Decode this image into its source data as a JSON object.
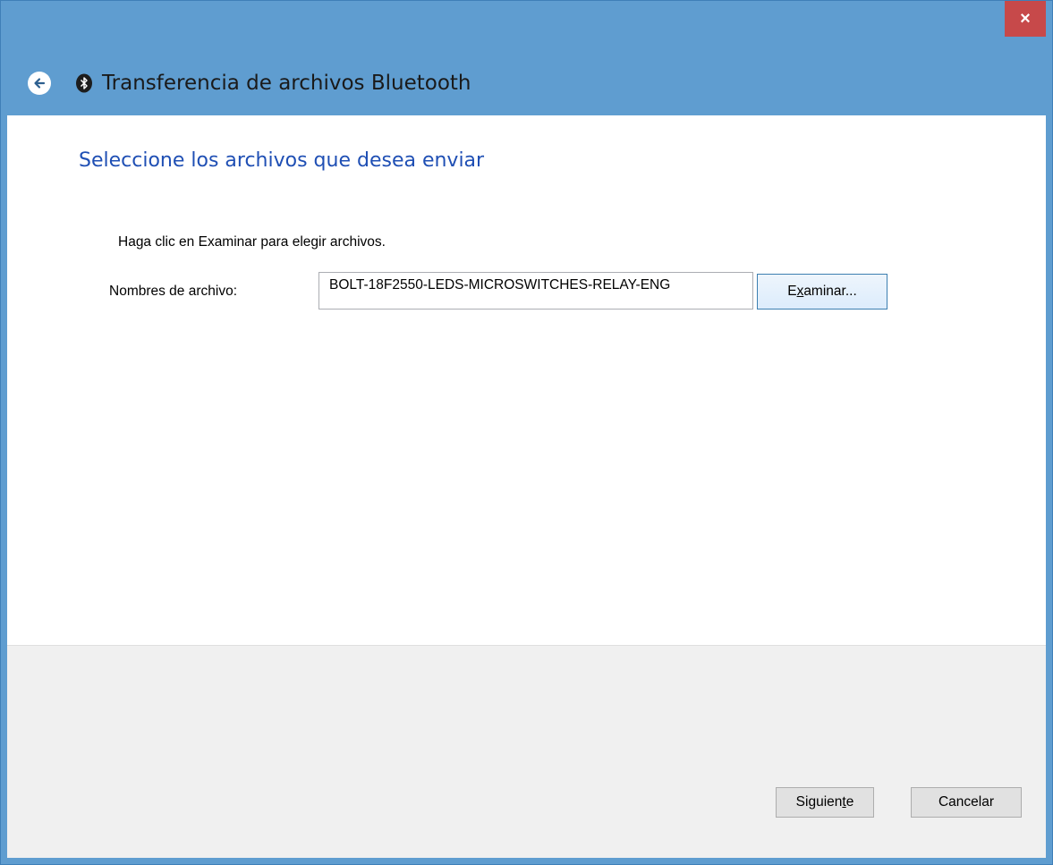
{
  "window": {
    "title": "Transferencia de archivos Bluetooth",
    "close_label": "×",
    "title_bar_color": "#5f9dd0",
    "close_color": "#c7494a"
  },
  "header": {
    "back_icon": "back-arrow-icon",
    "app_icon": "bluetooth-icon"
  },
  "page": {
    "heading": "Seleccione los archivos que desea enviar",
    "heading_color": "#1f4fb4",
    "instruction": "Haga clic en Examinar para elegir archivos.",
    "filename_label": "Nombres de archivo:",
    "filename_value": "BOLT-18F2550-LEDS-MICROSWITCHES-RELAY-ENG",
    "browse_label_pre": "E",
    "browse_label_key": "x",
    "browse_label_post": "aminar..."
  },
  "footer": {
    "next_label_pre": "Siguien",
    "next_label_key": "t",
    "next_label_post": "e",
    "cancel_label": "Cancelar"
  }
}
